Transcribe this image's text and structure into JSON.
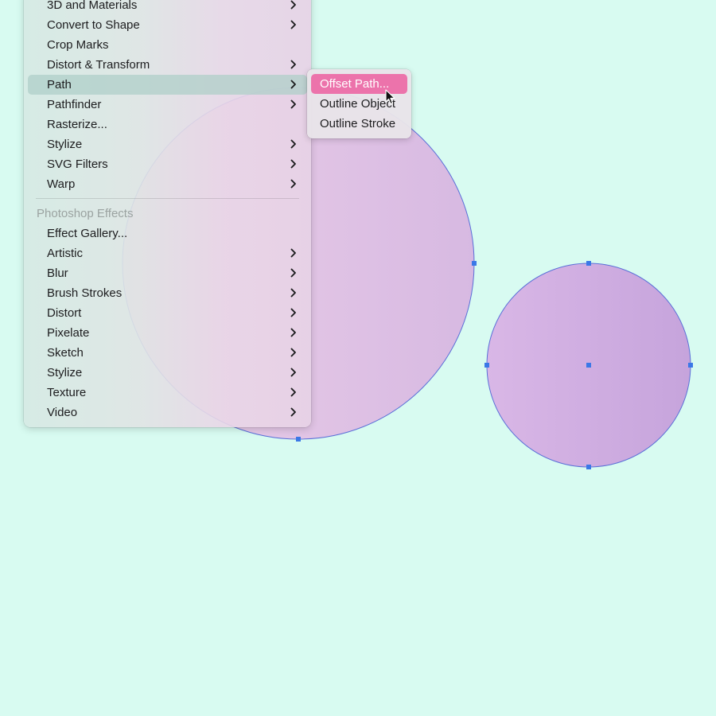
{
  "canvas": {
    "background_color": "#d8fbf1",
    "objects": [
      {
        "type": "circle",
        "name": "large-circle",
        "fill_left": "#ecd0e8",
        "fill_right": "#d7b9e2",
        "stroke": "#5a6fd8",
        "selected": false
      },
      {
        "type": "circle",
        "name": "small-circle",
        "fill_left": "#d9b7e6",
        "fill_right": "#c6a4dc",
        "stroke": "#5a6fd8",
        "selected": true
      }
    ],
    "anchor_color": "#3b78e7"
  },
  "effect_menu": {
    "illustrator_items": [
      {
        "label": "3D and Materials",
        "submenu": true
      },
      {
        "label": "Convert to Shape",
        "submenu": true
      },
      {
        "label": "Crop Marks",
        "submenu": false
      },
      {
        "label": "Distort & Transform",
        "submenu": true
      },
      {
        "label": "Path",
        "submenu": true,
        "highlighted": true
      },
      {
        "label": "Pathfinder",
        "submenu": true
      },
      {
        "label": "Rasterize...",
        "submenu": false
      },
      {
        "label": "Stylize",
        "submenu": true
      },
      {
        "label": "SVG Filters",
        "submenu": true
      },
      {
        "label": "Warp",
        "submenu": true
      }
    ],
    "photoshop_header": "Photoshop Effects",
    "photoshop_items": [
      {
        "label": "Effect Gallery...",
        "submenu": false
      },
      {
        "label": "Artistic",
        "submenu": true
      },
      {
        "label": "Blur",
        "submenu": true
      },
      {
        "label": "Brush Strokes",
        "submenu": true
      },
      {
        "label": "Distort",
        "submenu": true
      },
      {
        "label": "Pixelate",
        "submenu": true
      },
      {
        "label": "Sketch",
        "submenu": true
      },
      {
        "label": "Stylize",
        "submenu": true
      },
      {
        "label": "Texture",
        "submenu": true
      },
      {
        "label": "Video",
        "submenu": true
      }
    ]
  },
  "path_submenu": {
    "items": [
      {
        "label": "Offset Path...",
        "active": true
      },
      {
        "label": "Outline Object",
        "active": false
      },
      {
        "label": "Outline Stroke",
        "active": false
      }
    ],
    "active_color": "#ec73ab"
  },
  "cursor": {
    "icon": "arrow-pointer-icon"
  }
}
